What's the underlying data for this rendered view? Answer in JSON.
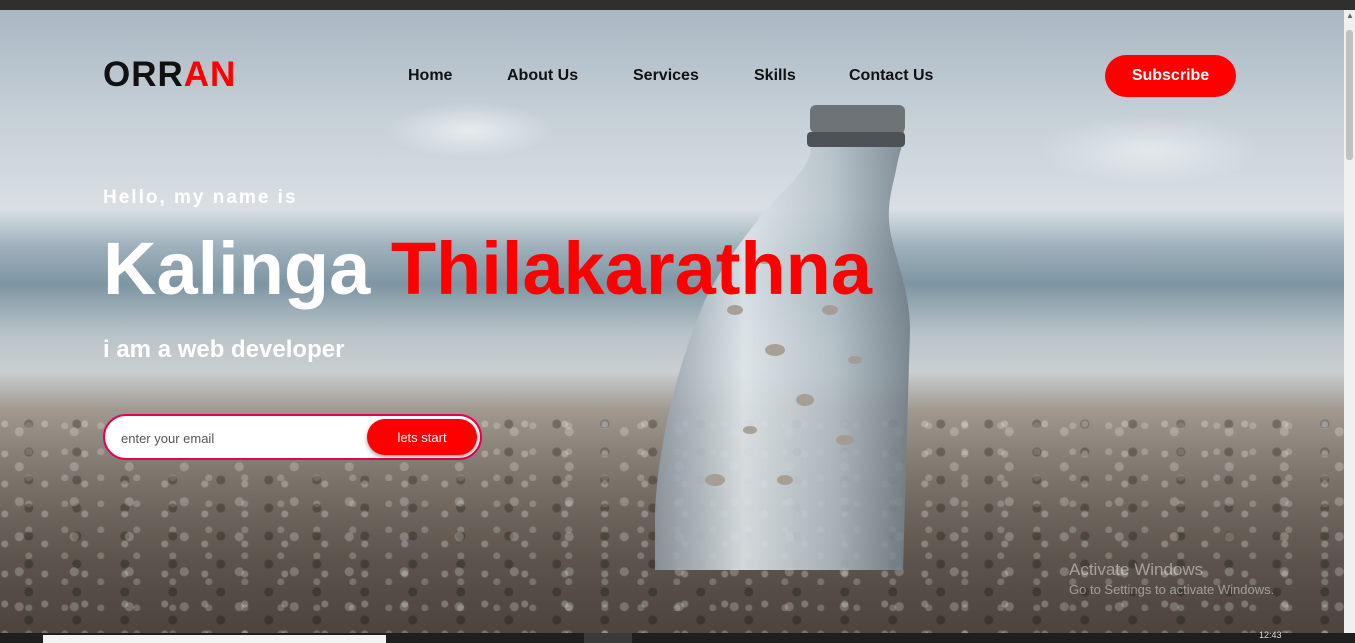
{
  "brand": {
    "part1": "ORR",
    "part2": "AN"
  },
  "nav": [
    "Home",
    "About Us",
    "Services",
    "Skills",
    "Contact Us"
  ],
  "subscribe_label": "Subscribe",
  "hero": {
    "greeting": "Hello, my name is",
    "first_name": "Kalinga",
    "last_name": "Thilakarathna",
    "role": "i am a web developer"
  },
  "form": {
    "email_placeholder": "enter your email",
    "button_label": "lets start"
  },
  "watermark": {
    "title": "Activate Windows",
    "subtitle": "Go to Settings to activate Windows."
  },
  "taskbar": {
    "clock": "12:43"
  },
  "colors": {
    "accent": "#ff0000",
    "text_dark": "#111111",
    "text_light": "#ffffff",
    "form_border": "#e8004d"
  },
  "icons": {
    "scroll_up": "triangle-up-icon"
  }
}
